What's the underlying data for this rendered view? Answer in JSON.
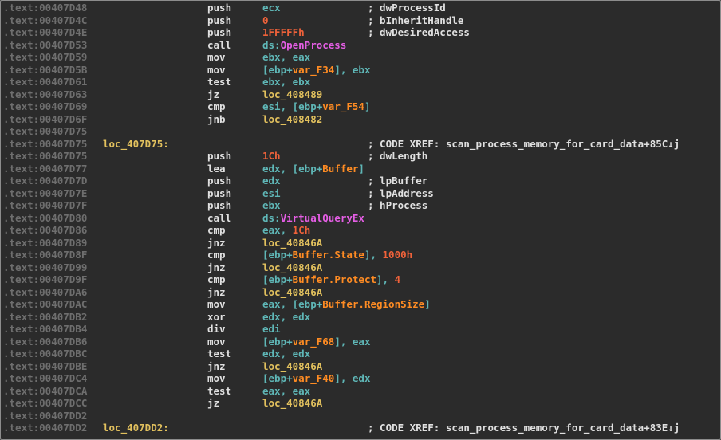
{
  "lines": [
    {
      "addr": ".text:00407D48",
      "label": "",
      "mnemonic": "push",
      "operands": [
        {
          "t": "reg",
          "v": "ecx"
        }
      ],
      "comment": "; dwProcessId"
    },
    {
      "addr": ".text:00407D4C",
      "label": "",
      "mnemonic": "push",
      "operands": [
        {
          "t": "num",
          "v": "0"
        }
      ],
      "comment": "; bInheritHandle"
    },
    {
      "addr": ".text:00407D4E",
      "label": "",
      "mnemonic": "push",
      "operands": [
        {
          "t": "num",
          "v": "1FFFFFh"
        }
      ],
      "comment": "; dwDesiredAccess"
    },
    {
      "addr": ".text:00407D53",
      "label": "",
      "mnemonic": "call",
      "operands": [
        {
          "t": "reg",
          "v": "ds:"
        },
        {
          "t": "imp",
          "v": "OpenProcess"
        }
      ],
      "comment": ""
    },
    {
      "addr": ".text:00407D59",
      "label": "",
      "mnemonic": "mov",
      "operands": [
        {
          "t": "reg",
          "v": "ebx, eax"
        }
      ],
      "comment": ""
    },
    {
      "addr": ".text:00407D5B",
      "label": "",
      "mnemonic": "mov",
      "operands": [
        {
          "t": "reg",
          "v": "[ebp+"
        },
        {
          "t": "var",
          "v": "var_F34"
        },
        {
          "t": "reg",
          "v": "], ebx"
        }
      ],
      "comment": ""
    },
    {
      "addr": ".text:00407D61",
      "label": "",
      "mnemonic": "test",
      "operands": [
        {
          "t": "reg",
          "v": "ebx, ebx"
        }
      ],
      "comment": ""
    },
    {
      "addr": ".text:00407D63",
      "label": "",
      "mnemonic": "jz",
      "operands": [
        {
          "t": "lbl",
          "v": "loc_408489"
        }
      ],
      "comment": ""
    },
    {
      "addr": ".text:00407D69",
      "label": "",
      "mnemonic": "cmp",
      "operands": [
        {
          "t": "reg",
          "v": "esi, [ebp+"
        },
        {
          "t": "var",
          "v": "var_F54"
        },
        {
          "t": "reg",
          "v": "]"
        }
      ],
      "comment": ""
    },
    {
      "addr": ".text:00407D6F",
      "label": "",
      "mnemonic": "jnb",
      "operands": [
        {
          "t": "lbl",
          "v": "loc_408482"
        }
      ],
      "comment": ""
    },
    {
      "addr": ".text:00407D75",
      "label": "",
      "mnemonic": "",
      "operands": [],
      "comment": ""
    },
    {
      "addr": ".text:00407D75",
      "label": "loc_407D75:",
      "mnemonic": "",
      "operands": [],
      "comment": "; CODE XREF: scan_process_memory_for_card_data+85C↓j"
    },
    {
      "addr": ".text:00407D75",
      "label": "",
      "mnemonic": "push",
      "operands": [
        {
          "t": "num",
          "v": "1Ch"
        }
      ],
      "comment": "; dwLength"
    },
    {
      "addr": ".text:00407D77",
      "label": "",
      "mnemonic": "lea",
      "operands": [
        {
          "t": "reg",
          "v": "edx, [ebp+"
        },
        {
          "t": "var",
          "v": "Buffer"
        },
        {
          "t": "reg",
          "v": "]"
        }
      ],
      "comment": ""
    },
    {
      "addr": ".text:00407D7D",
      "label": "",
      "mnemonic": "push",
      "operands": [
        {
          "t": "reg",
          "v": "edx"
        }
      ],
      "comment": "; lpBuffer"
    },
    {
      "addr": ".text:00407D7E",
      "label": "",
      "mnemonic": "push",
      "operands": [
        {
          "t": "reg",
          "v": "esi"
        }
      ],
      "comment": "; lpAddress"
    },
    {
      "addr": ".text:00407D7F",
      "label": "",
      "mnemonic": "push",
      "operands": [
        {
          "t": "reg",
          "v": "ebx"
        }
      ],
      "comment": "; hProcess"
    },
    {
      "addr": ".text:00407D80",
      "label": "",
      "mnemonic": "call",
      "operands": [
        {
          "t": "reg",
          "v": "ds:"
        },
        {
          "t": "imp",
          "v": "VirtualQueryEx"
        }
      ],
      "comment": ""
    },
    {
      "addr": ".text:00407D86",
      "label": "",
      "mnemonic": "cmp",
      "operands": [
        {
          "t": "reg",
          "v": "eax, "
        },
        {
          "t": "num",
          "v": "1Ch"
        }
      ],
      "comment": ""
    },
    {
      "addr": ".text:00407D89",
      "label": "",
      "mnemonic": "jnz",
      "operands": [
        {
          "t": "lbl",
          "v": "loc_40846A"
        }
      ],
      "comment": ""
    },
    {
      "addr": ".text:00407D8F",
      "label": "",
      "mnemonic": "cmp",
      "operands": [
        {
          "t": "reg",
          "v": "[ebp+"
        },
        {
          "t": "var",
          "v": "Buffer.State"
        },
        {
          "t": "reg",
          "v": "], "
        },
        {
          "t": "num",
          "v": "1000h"
        }
      ],
      "comment": ""
    },
    {
      "addr": ".text:00407D99",
      "label": "",
      "mnemonic": "jnz",
      "operands": [
        {
          "t": "lbl",
          "v": "loc_40846A"
        }
      ],
      "comment": ""
    },
    {
      "addr": ".text:00407D9F",
      "label": "",
      "mnemonic": "cmp",
      "operands": [
        {
          "t": "reg",
          "v": "[ebp+"
        },
        {
          "t": "var",
          "v": "Buffer.Protect"
        },
        {
          "t": "reg",
          "v": "], "
        },
        {
          "t": "num",
          "v": "4"
        }
      ],
      "comment": ""
    },
    {
      "addr": ".text:00407DA6",
      "label": "",
      "mnemonic": "jnz",
      "operands": [
        {
          "t": "lbl",
          "v": "loc_40846A"
        }
      ],
      "comment": ""
    },
    {
      "addr": ".text:00407DAC",
      "label": "",
      "mnemonic": "mov",
      "operands": [
        {
          "t": "reg",
          "v": "eax, [ebp+"
        },
        {
          "t": "var",
          "v": "Buffer.RegionSize"
        },
        {
          "t": "reg",
          "v": "]"
        }
      ],
      "comment": ""
    },
    {
      "addr": ".text:00407DB2",
      "label": "",
      "mnemonic": "xor",
      "operands": [
        {
          "t": "reg",
          "v": "edx, edx"
        }
      ],
      "comment": ""
    },
    {
      "addr": ".text:00407DB4",
      "label": "",
      "mnemonic": "div",
      "operands": [
        {
          "t": "reg",
          "v": "edi"
        }
      ],
      "comment": ""
    },
    {
      "addr": ".text:00407DB6",
      "label": "",
      "mnemonic": "mov",
      "operands": [
        {
          "t": "reg",
          "v": "[ebp+"
        },
        {
          "t": "var",
          "v": "var_F68"
        },
        {
          "t": "reg",
          "v": "], eax"
        }
      ],
      "comment": ""
    },
    {
      "addr": ".text:00407DBC",
      "label": "",
      "mnemonic": "test",
      "operands": [
        {
          "t": "reg",
          "v": "edx, edx"
        }
      ],
      "comment": ""
    },
    {
      "addr": ".text:00407DBE",
      "label": "",
      "mnemonic": "jnz",
      "operands": [
        {
          "t": "lbl",
          "v": "loc_40846A"
        }
      ],
      "comment": ""
    },
    {
      "addr": ".text:00407DC4",
      "label": "",
      "mnemonic": "mov",
      "operands": [
        {
          "t": "reg",
          "v": "[ebp+"
        },
        {
          "t": "var",
          "v": "var_F40"
        },
        {
          "t": "reg",
          "v": "], edx"
        }
      ],
      "comment": ""
    },
    {
      "addr": ".text:00407DCA",
      "label": "",
      "mnemonic": "test",
      "operands": [
        {
          "t": "reg",
          "v": "eax, eax"
        }
      ],
      "comment": ""
    },
    {
      "addr": ".text:00407DCC",
      "label": "",
      "mnemonic": "jz",
      "operands": [
        {
          "t": "lbl",
          "v": "loc_40846A"
        }
      ],
      "comment": ""
    },
    {
      "addr": ".text:00407DD2",
      "label": "",
      "mnemonic": "",
      "operands": [],
      "comment": ""
    },
    {
      "addr": ".text:00407DD2",
      "label": "loc_407DD2:",
      "mnemonic": "",
      "operands": [],
      "comment": "; CODE XREF: scan_process_memory_for_card_data+83E↓j"
    }
  ],
  "colors": {
    "background": "#2b2b2b",
    "address": "#6e6e6e",
    "label": "#e2c15e",
    "mnemonic": "#e0e0e0",
    "register": "#5fb7b7",
    "number": "#f0623a",
    "variable": "#ff8c23",
    "import": "#e55ee5",
    "comment": "#e0e0e0"
  }
}
